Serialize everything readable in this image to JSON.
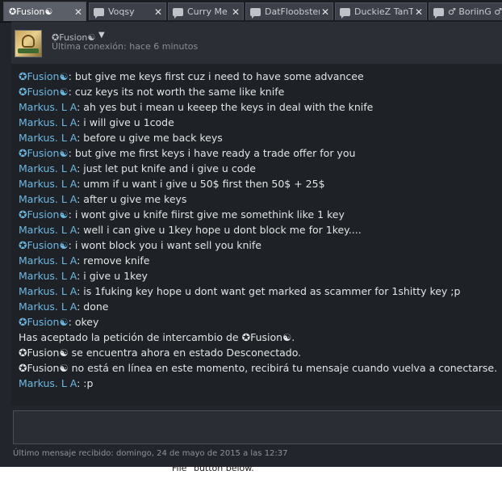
{
  "tabs": [
    {
      "label": "✪Fusion☯",
      "active": true
    },
    {
      "label": "Voqsy",
      "active": false
    },
    {
      "label": "Curry Me",
      "active": false
    },
    {
      "label": "DatFloobster",
      "active": false
    },
    {
      "label": "DuckieZ TanT",
      "active": false
    },
    {
      "label": "♂ BoriinG ♂",
      "active": false
    }
  ],
  "close_glyph": "✕",
  "header": {
    "name": "✪Fusion☯",
    "caret": "▼",
    "status": "Última conexión: hace 6 minutos"
  },
  "messages": [
    {
      "sender": "✪Fusion☯",
      "text": ": but give me keys first cuz i need to have  some advancee"
    },
    {
      "sender": "✪Fusion☯",
      "text": ": cuz keys its not worth the same like knife"
    },
    {
      "sender": "Markus. L A",
      "text": ": ah yes but i mean u keeep the keys in deal with the knife"
    },
    {
      "sender": "Markus. L A",
      "text": ": i will give u 1code"
    },
    {
      "sender": "Markus. L A",
      "text": ": before u give me back keys"
    },
    {
      "sender": "✪Fusion☯",
      "text": ": but give me first keys i have ready a trade offer for you"
    },
    {
      "sender": "Markus. L A",
      "text": ": just let put knife and i give u code"
    },
    {
      "sender": "Markus. L A",
      "text": ": umm if u want i give u 50$ first then 50$ + 25$"
    },
    {
      "sender": "Markus. L A",
      "text": ": after u give me keys"
    },
    {
      "sender": "✪Fusion☯",
      "text": ": i wont give u knife fiirst give me somethink like 1 key"
    },
    {
      "sender": "Markus. L A",
      "text": ": well i can give u 1key hope u dont block me for 1key...."
    },
    {
      "sender": "✪Fusion☯",
      "text": ": i wont block you i want sell you knife"
    },
    {
      "sender": "Markus. L A",
      "text": ": remove knife"
    },
    {
      "sender": "Markus. L A",
      "text": ": i give u 1key"
    },
    {
      "sender": "Markus. L A",
      "text": ": is 1fuking key hope u dont want get marked as scammer for 1shitty key ;p"
    },
    {
      "sender": "Markus. L A",
      "text": ": done"
    },
    {
      "sender": "✪Fusion☯",
      "text": ": okey"
    }
  ],
  "system_messages": [
    "Has aceptado la petición de intercambio de ✪Fusion☯.",
    "✪Fusion☯ se encuentra ahora en estado Desconectado.",
    "✪Fusion☯ no está en línea en este momento, recibirá tu mensaje cuando vuelva a conectarse."
  ],
  "last_message": {
    "sender": "Markus. L A",
    "text": ": :p"
  },
  "input": {
    "value": "",
    "placeholder": ""
  },
  "footer": "Último mensaje recibido: domingo, 24 de mayo de 2015 a las 12:37",
  "below_text": "File\" button below.",
  "colors": {
    "background": "#1e2125",
    "sender_name": "#6db8e3",
    "text": "#e2e4e6"
  }
}
